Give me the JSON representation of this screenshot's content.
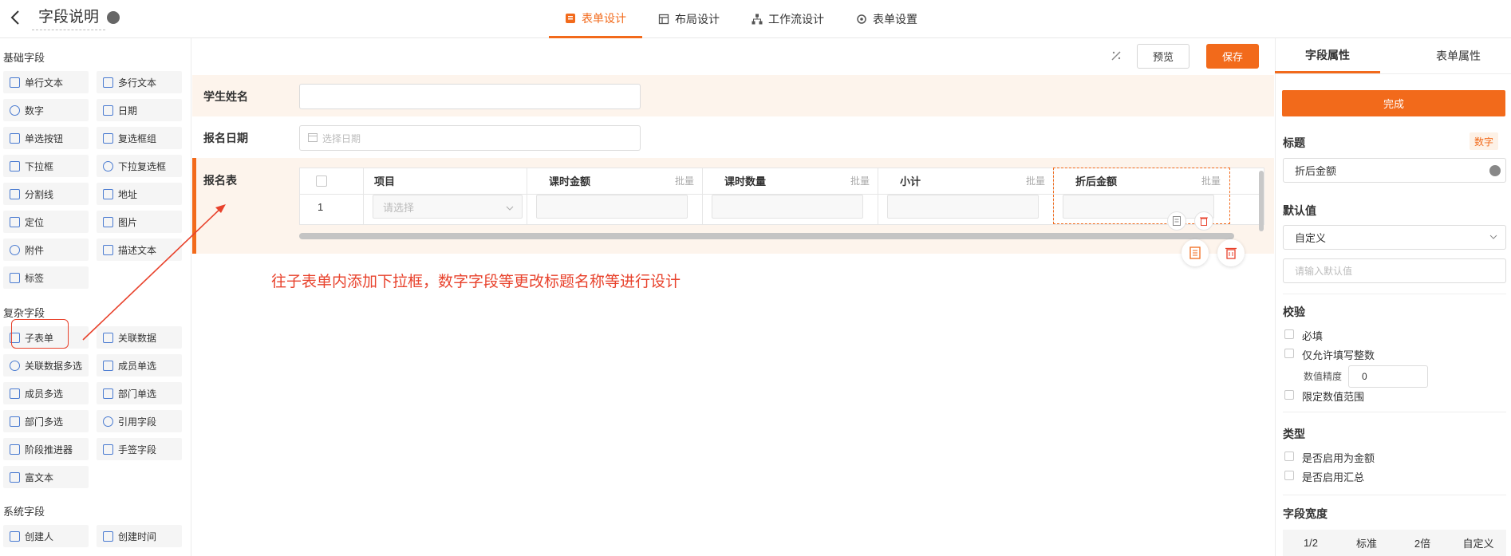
{
  "header": {
    "title": "字段说明",
    "tabs": [
      {
        "label": "表单设计",
        "active": true
      },
      {
        "label": "布局设计",
        "active": false
      },
      {
        "label": "工作流设计",
        "active": false
      },
      {
        "label": "表单设置",
        "active": false
      }
    ]
  },
  "left": {
    "basic_title": "基础字段",
    "basic": [
      "单行文本",
      "多行文本",
      "数字",
      "日期",
      "单选按钮",
      "复选框组",
      "下拉框",
      "下拉复选框",
      "分割线",
      "地址",
      "定位",
      "图片",
      "附件",
      "描述文本",
      "标签"
    ],
    "complex_title": "复杂字段",
    "complex": [
      "子表单",
      "关联数据",
      "关联数据多选",
      "成员单选",
      "成员多选",
      "部门单选",
      "部门多选",
      "引用字段",
      "阶段推进器",
      "手签字段",
      "富文本"
    ],
    "system_title": "系统字段",
    "system": [
      "创建人",
      "创建时间"
    ]
  },
  "toolbar": {
    "preview": "预览",
    "save": "保存"
  },
  "form": {
    "row1_label": "学生姓名",
    "row2_label": "报名日期",
    "row2_placeholder": "选择日期",
    "row3_label": "报名表",
    "sub_cols": [
      "项目",
      "课时金额",
      "课时数量",
      "小计",
      "折后金额"
    ],
    "batch": "批量",
    "row_no": "1",
    "select_placeholder": "请选择"
  },
  "annotation": "往子表单内添加下拉框，数字字段等更改标题名称等进行设计",
  "right": {
    "tab_field": "字段属性",
    "tab_form": "表单属性",
    "done": "完成",
    "title_label": "标题",
    "type_badge": "数字",
    "title_value": "折后金额",
    "default_label": "默认值",
    "default_mode": "自定义",
    "default_placeholder": "请输入默认值",
    "validate_label": "校验",
    "required": "必填",
    "integer_only": "仅允许填写整数",
    "precision_label": "数值精度",
    "precision_value": "0",
    "limit_range": "限定数值范围",
    "type_label": "类型",
    "as_amount": "是否启用为金额",
    "as_sum": "是否启用汇总",
    "width_label": "字段宽度",
    "widths": [
      "1/2",
      "标准",
      "2倍",
      "自定义"
    ]
  },
  "colors": {
    "accent": "#f26a1b",
    "annotation": "#e8422c",
    "icon": "#4a7bd1"
  }
}
